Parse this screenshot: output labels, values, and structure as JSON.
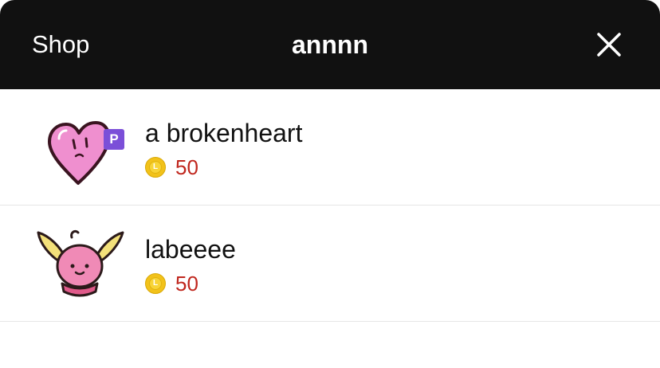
{
  "header": {
    "back_label": "Shop",
    "title": "annnn",
    "close_icon": "close-icon"
  },
  "items": [
    {
      "name": "a brokenheart",
      "price": "50",
      "currency_badge": "L",
      "thumbnail_icon": "heart-sticker-icon",
      "premium": false
    },
    {
      "name": "labeeee",
      "price": "50",
      "currency_badge": "L",
      "thumbnail_icon": "pink-creature-sticker-icon",
      "premium": true,
      "premium_badge": "P"
    }
  ],
  "colors": {
    "header_bg": "#111111",
    "price": "#c0271e",
    "coin": "#f2c21a",
    "premium_badge": "#7b4fd8"
  }
}
